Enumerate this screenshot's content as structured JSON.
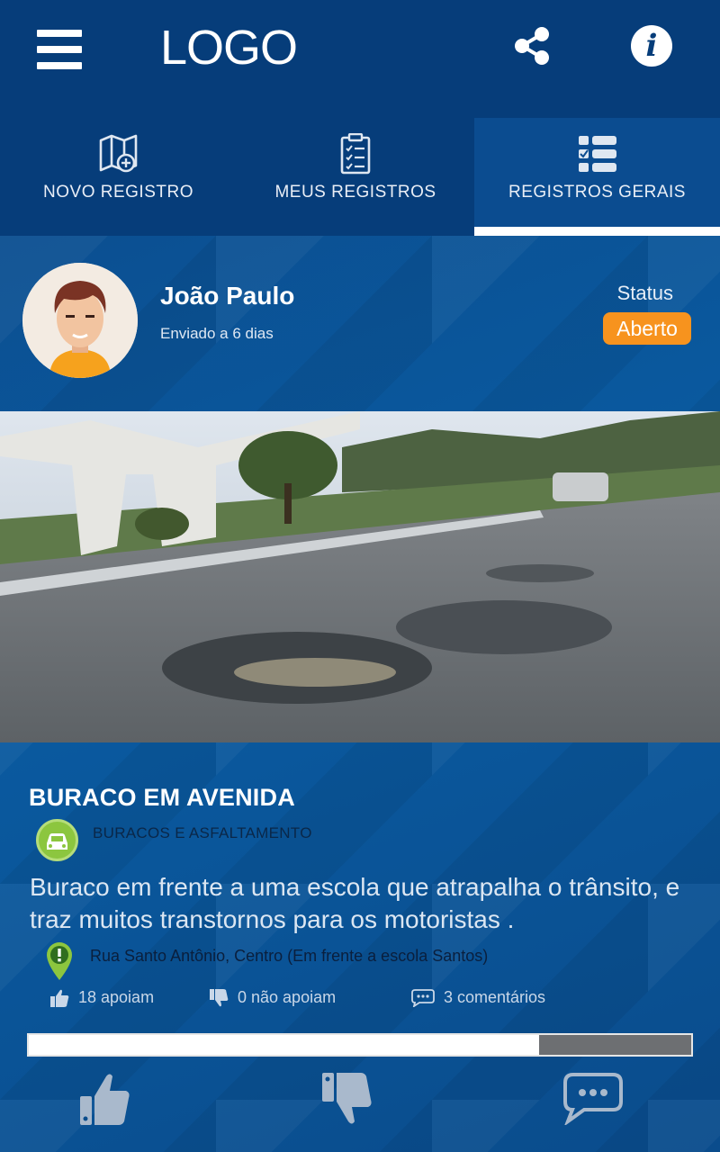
{
  "header": {
    "logo_text": "LOGO",
    "menu_icon": "hamburger-menu-icon",
    "share_icon": "share-icon",
    "info_icon": "info-icon",
    "info_glyph": "i"
  },
  "tabs": [
    {
      "label": "NOVO REGISTRO",
      "icon": "map-add-icon",
      "active": false
    },
    {
      "label": "MEUS REGISTROS",
      "icon": "clipboard-list-icon",
      "active": false
    },
    {
      "label": "REGISTROS GERAIS",
      "icon": "checklist-icon",
      "active": true
    }
  ],
  "post": {
    "user": {
      "name": "João Paulo",
      "sent": "Enviado a 6 dias"
    },
    "status": {
      "label": "Status",
      "value": "Aberto",
      "color": "#f7931e"
    },
    "title": "BURACO EM AVENIDA",
    "category": {
      "label": "BURACOS E ASFALTAMENTO",
      "icon": "car-icon",
      "color": "#8cc63f"
    },
    "description": "Buraco em frente a uma escola que atrapalha o trânsito, e traz muitos transtornos para os motoristas .",
    "location": {
      "text": "Rua Santo Antônio, Centro (Em frente a escola Santos)",
      "icon": "location-pin-icon"
    },
    "stats": {
      "support": "18 apoiam",
      "not_support": "0 não apoiam",
      "comments": "3 comentários"
    },
    "progress": 0.77
  },
  "actions": {
    "support_icon": "thumbs-up-icon",
    "not_support_icon": "thumbs-down-icon",
    "comment_icon": "comment-bubble-icon"
  },
  "colors": {
    "topbar": "#063d7a",
    "accent": "#0b4c90",
    "status": "#f7931e",
    "category": "#8cc63f"
  }
}
